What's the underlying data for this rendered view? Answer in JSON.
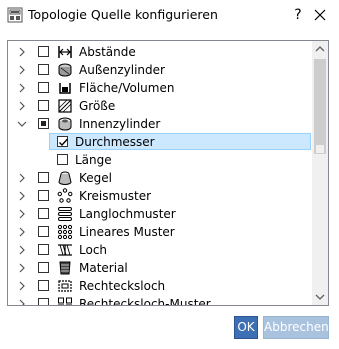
{
  "window": {
    "title": "Topologie Quelle konfigurieren",
    "help_label": "?"
  },
  "tree": {
    "items": [
      {
        "label": "Abstände",
        "icon": "distance-icon",
        "expanded": false,
        "state": "unchecked"
      },
      {
        "label": "Außenzylinder",
        "icon": "outer-cylinder-icon",
        "expanded": false,
        "state": "unchecked"
      },
      {
        "label": "Fläche/Volumen",
        "icon": "area-volume-icon",
        "expanded": false,
        "state": "unchecked"
      },
      {
        "label": "Größe",
        "icon": "size-icon",
        "expanded": false,
        "state": "unchecked"
      },
      {
        "label": "Innenzylinder",
        "icon": "inner-cylinder-icon",
        "expanded": true,
        "state": "partial",
        "children": [
          {
            "label": "Durchmesser",
            "state": "checked",
            "selected": true
          },
          {
            "label": "Länge",
            "state": "unchecked",
            "selected": false
          }
        ]
      },
      {
        "label": "Kegel",
        "icon": "cone-icon",
        "expanded": false,
        "state": "unchecked"
      },
      {
        "label": "Kreismuster",
        "icon": "circular-pattern-icon",
        "expanded": false,
        "state": "unchecked"
      },
      {
        "label": "Langlochmuster",
        "icon": "slot-pattern-icon",
        "expanded": false,
        "state": "unchecked"
      },
      {
        "label": "Lineares Muster",
        "icon": "linear-pattern-icon",
        "expanded": false,
        "state": "unchecked"
      },
      {
        "label": "Loch",
        "icon": "hole-icon",
        "expanded": false,
        "state": "unchecked"
      },
      {
        "label": "Material",
        "icon": "material-icon",
        "expanded": false,
        "state": "unchecked"
      },
      {
        "label": "Rechtecksloch",
        "icon": "rect-hole-icon",
        "expanded": false,
        "state": "unchecked"
      },
      {
        "label": "Rechtecksloch-Muster",
        "icon": "rect-hole-pattern-icon",
        "expanded": false,
        "state": "unchecked"
      }
    ]
  },
  "buttons": {
    "ok_label": "OK",
    "cancel_label": "Abbrechen"
  },
  "colors": {
    "selection": "#cce8ff",
    "primary_button": "#3c6fb4",
    "disabled_button": "#a9c2de"
  }
}
